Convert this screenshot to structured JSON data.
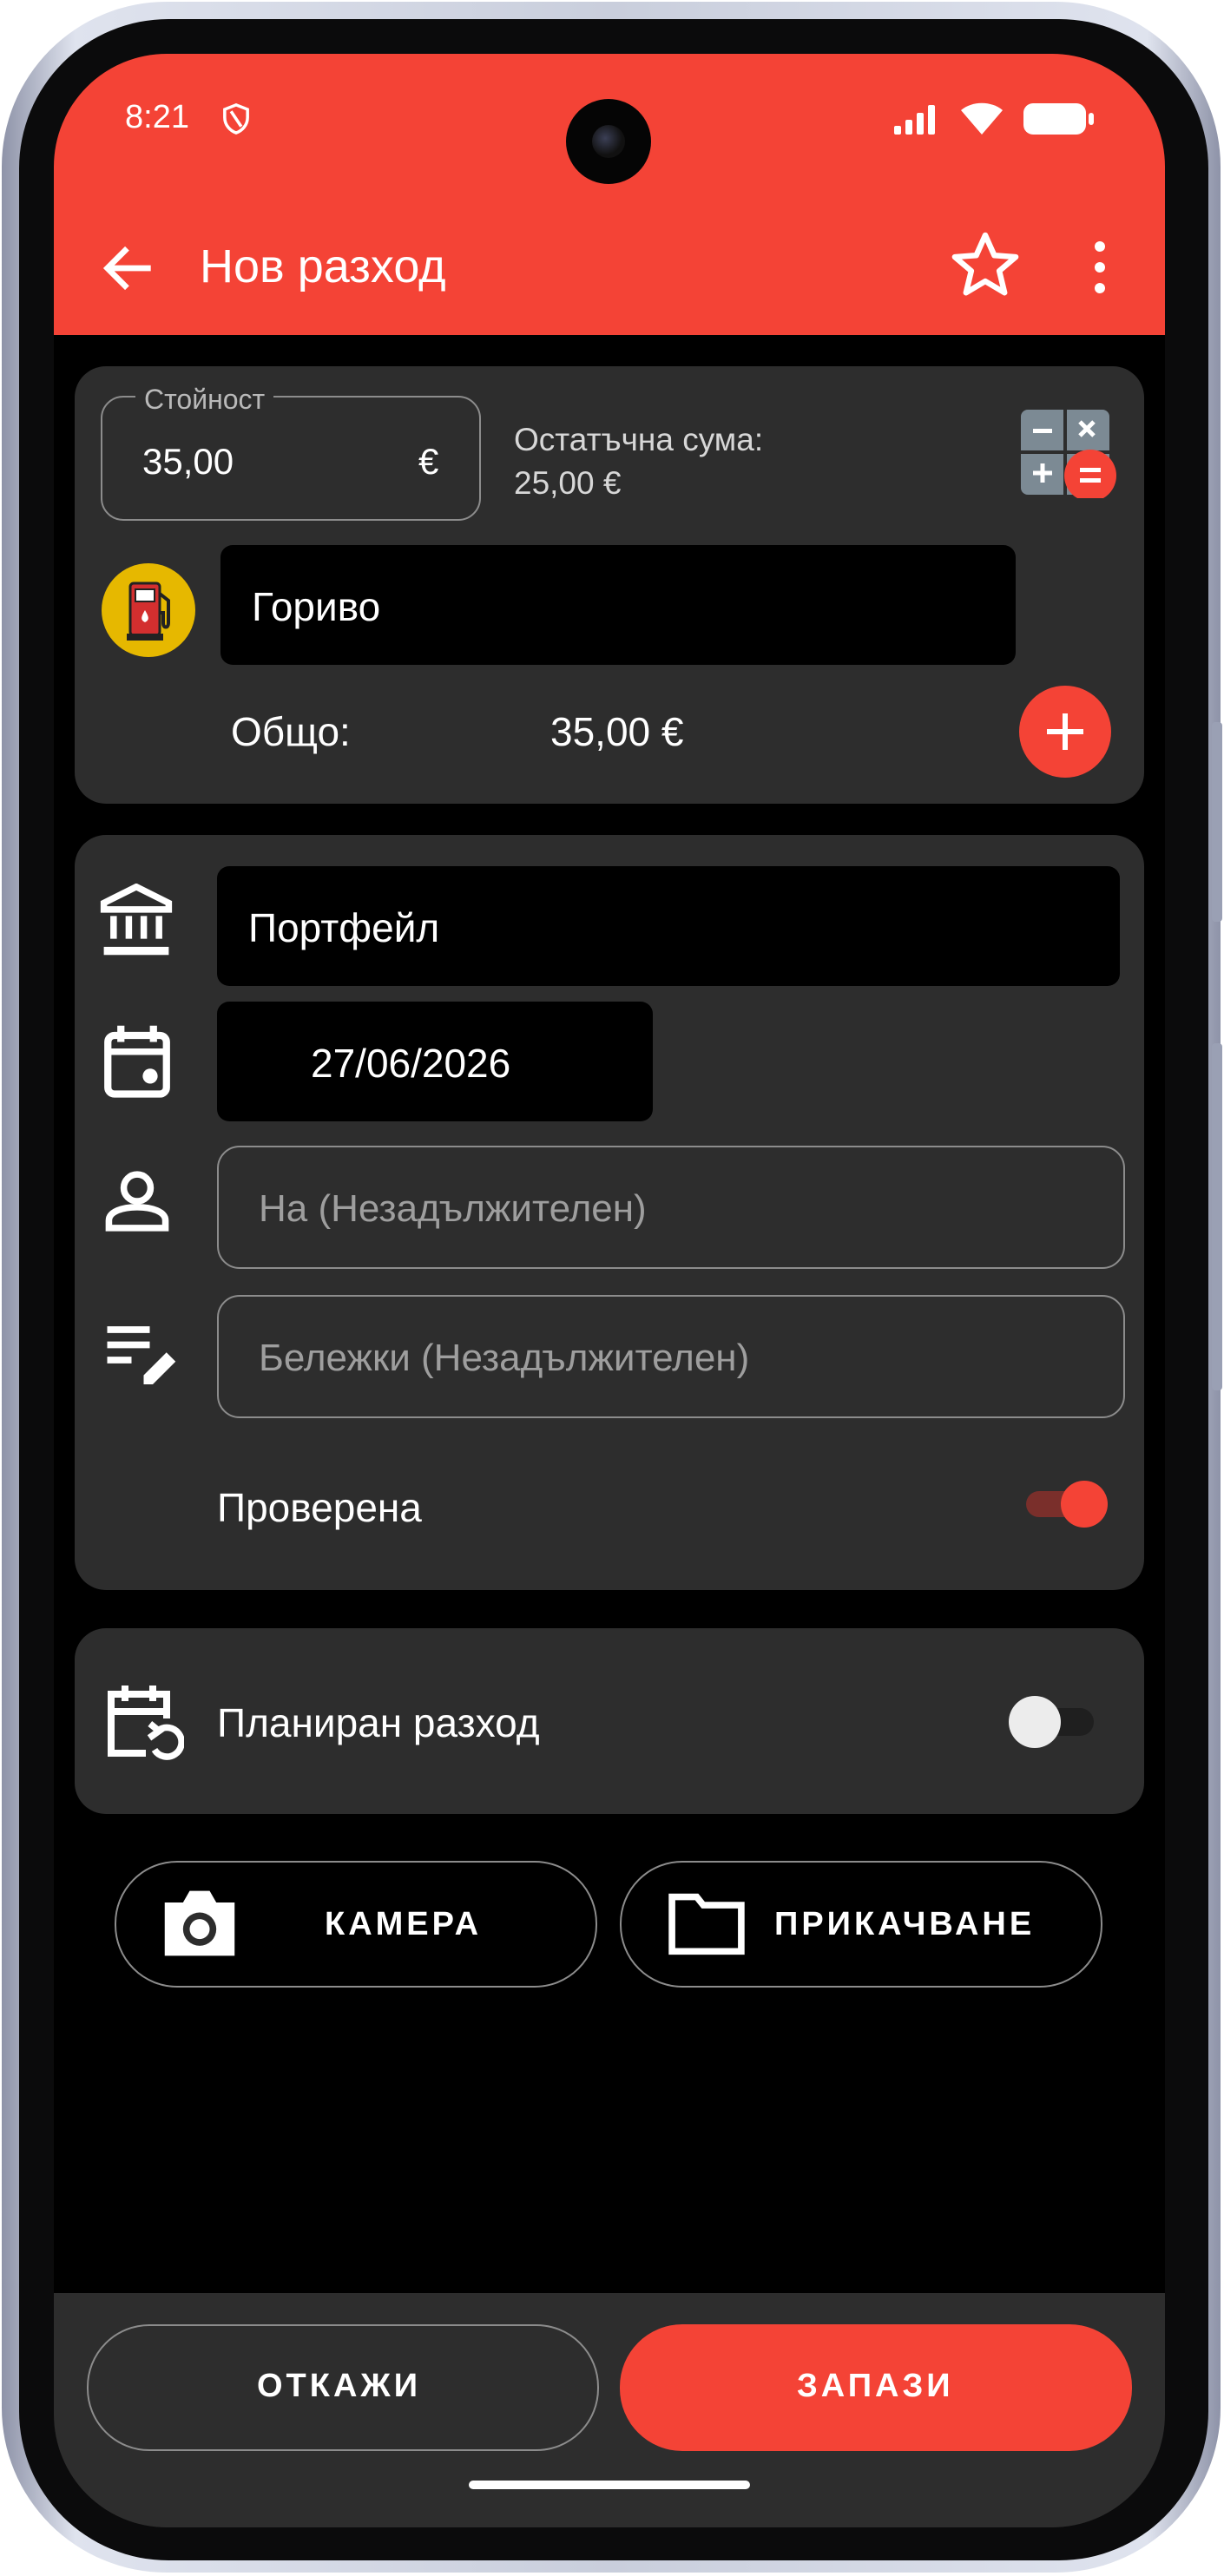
{
  "status_bar": {
    "time": "8:21"
  },
  "app_bar": {
    "title": "Нов разход"
  },
  "amount_card": {
    "value_label": "Стойност",
    "value": "35,00",
    "currency": "€",
    "remaining_label": "Остатъчна сума:",
    "remaining_value": "25,00 €",
    "category": "Гориво",
    "total_label": "Общо:",
    "total_value": "35,00 €"
  },
  "details_card": {
    "account": "Портфейл",
    "date": "27/06/2026",
    "payee_placeholder": "На (Незадължителен)",
    "notes_placeholder": "Бележки (Незадължителен)",
    "verified_label": "Проверена",
    "verified_on": true
  },
  "scheduled_card": {
    "label": "Планиран разход",
    "enabled": false
  },
  "attachments": {
    "camera_label": "КАМЕРА",
    "attach_label": "ПРИКАЧВАНЕ"
  },
  "footer": {
    "cancel_label": "ОТКАЖИ",
    "save_label": "ЗАПАЗИ"
  },
  "colors": {
    "accent": "#f44336",
    "card": "#2d2d2d",
    "background": "#000000"
  },
  "icons": [
    "back-arrow-icon",
    "star-icon",
    "more-vert-icon",
    "calculator-icon",
    "fuel-pump-icon",
    "plus-icon",
    "bank-icon",
    "calendar-icon",
    "person-icon",
    "notes-edit-icon",
    "calendar-repeat-icon",
    "camera-icon",
    "folder-icon"
  ]
}
